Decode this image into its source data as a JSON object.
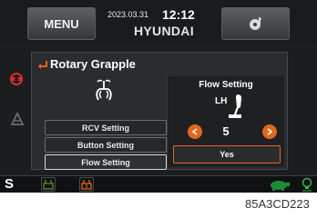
{
  "header": {
    "menu_label": "MENU",
    "date": "2023.03.31",
    "time": "12:12",
    "brand": "HYUNDAI",
    "media_icon": "media-icon"
  },
  "dialog": {
    "title": "Rotary Grapple",
    "options": [
      "RCV Setting",
      "Button Setting",
      "Flow Setting"
    ],
    "selected_option": "Flow Setting",
    "right": {
      "title": "Flow Setting",
      "side": "LH",
      "value": "5",
      "confirm_label": "Yes"
    }
  },
  "bottom": {
    "mode_letter": "S"
  },
  "caption": "85A3CD223"
}
